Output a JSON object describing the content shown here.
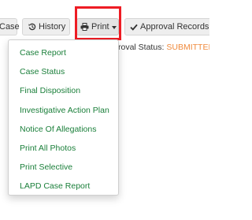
{
  "toolbar": {
    "case_label": "Case",
    "history_label": "History",
    "print_label": "Print",
    "approval_label": "Approval Records",
    "icons": {
      "history": "history-icon",
      "print": "print-icon",
      "approval": "check-icon",
      "caret": "caret-down-icon"
    }
  },
  "approval_status": {
    "label": "roval Status:",
    "value": "SUBMITTED",
    "value_color": "#f08a3c"
  },
  "print_menu": {
    "items": [
      {
        "label": "Case Report"
      },
      {
        "label": "Case Status"
      },
      {
        "label": "Final Disposition"
      },
      {
        "label": "Investigative Action Plan"
      },
      {
        "label": "Notice Of Allegations"
      },
      {
        "label": "Print All Photos"
      },
      {
        "label": "Print Selective"
      },
      {
        "label": "LAPD Case Report"
      }
    ],
    "item_color": "#1a7f3a"
  },
  "highlight_color": "#ee1c24"
}
